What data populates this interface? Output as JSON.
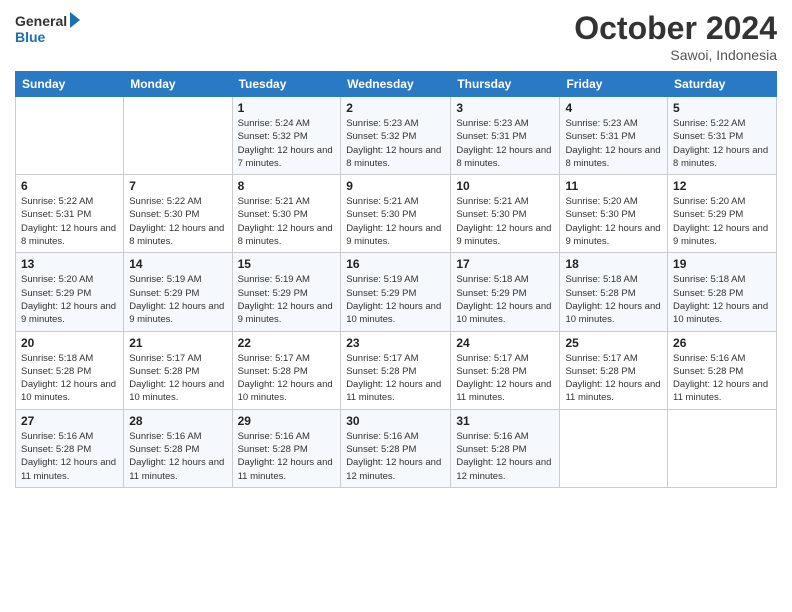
{
  "header": {
    "logo_general": "General",
    "logo_blue": "Blue",
    "month_title": "October 2024",
    "location": "Sawoi, Indonesia"
  },
  "days_of_week": [
    "Sunday",
    "Monday",
    "Tuesday",
    "Wednesday",
    "Thursday",
    "Friday",
    "Saturday"
  ],
  "weeks": [
    [
      {
        "day": "",
        "sunrise": "",
        "sunset": "",
        "daylight": ""
      },
      {
        "day": "",
        "sunrise": "",
        "sunset": "",
        "daylight": ""
      },
      {
        "day": "1",
        "sunrise": "Sunrise: 5:24 AM",
        "sunset": "Sunset: 5:32 PM",
        "daylight": "Daylight: 12 hours and 7 minutes."
      },
      {
        "day": "2",
        "sunrise": "Sunrise: 5:23 AM",
        "sunset": "Sunset: 5:32 PM",
        "daylight": "Daylight: 12 hours and 8 minutes."
      },
      {
        "day": "3",
        "sunrise": "Sunrise: 5:23 AM",
        "sunset": "Sunset: 5:31 PM",
        "daylight": "Daylight: 12 hours and 8 minutes."
      },
      {
        "day": "4",
        "sunrise": "Sunrise: 5:23 AM",
        "sunset": "Sunset: 5:31 PM",
        "daylight": "Daylight: 12 hours and 8 minutes."
      },
      {
        "day": "5",
        "sunrise": "Sunrise: 5:22 AM",
        "sunset": "Sunset: 5:31 PM",
        "daylight": "Daylight: 12 hours and 8 minutes."
      }
    ],
    [
      {
        "day": "6",
        "sunrise": "Sunrise: 5:22 AM",
        "sunset": "Sunset: 5:31 PM",
        "daylight": "Daylight: 12 hours and 8 minutes."
      },
      {
        "day": "7",
        "sunrise": "Sunrise: 5:22 AM",
        "sunset": "Sunset: 5:30 PM",
        "daylight": "Daylight: 12 hours and 8 minutes."
      },
      {
        "day": "8",
        "sunrise": "Sunrise: 5:21 AM",
        "sunset": "Sunset: 5:30 PM",
        "daylight": "Daylight: 12 hours and 8 minutes."
      },
      {
        "day": "9",
        "sunrise": "Sunrise: 5:21 AM",
        "sunset": "Sunset: 5:30 PM",
        "daylight": "Daylight: 12 hours and 9 minutes."
      },
      {
        "day": "10",
        "sunrise": "Sunrise: 5:21 AM",
        "sunset": "Sunset: 5:30 PM",
        "daylight": "Daylight: 12 hours and 9 minutes."
      },
      {
        "day": "11",
        "sunrise": "Sunrise: 5:20 AM",
        "sunset": "Sunset: 5:30 PM",
        "daylight": "Daylight: 12 hours and 9 minutes."
      },
      {
        "day": "12",
        "sunrise": "Sunrise: 5:20 AM",
        "sunset": "Sunset: 5:29 PM",
        "daylight": "Daylight: 12 hours and 9 minutes."
      }
    ],
    [
      {
        "day": "13",
        "sunrise": "Sunrise: 5:20 AM",
        "sunset": "Sunset: 5:29 PM",
        "daylight": "Daylight: 12 hours and 9 minutes."
      },
      {
        "day": "14",
        "sunrise": "Sunrise: 5:19 AM",
        "sunset": "Sunset: 5:29 PM",
        "daylight": "Daylight: 12 hours and 9 minutes."
      },
      {
        "day": "15",
        "sunrise": "Sunrise: 5:19 AM",
        "sunset": "Sunset: 5:29 PM",
        "daylight": "Daylight: 12 hours and 9 minutes."
      },
      {
        "day": "16",
        "sunrise": "Sunrise: 5:19 AM",
        "sunset": "Sunset: 5:29 PM",
        "daylight": "Daylight: 12 hours and 10 minutes."
      },
      {
        "day": "17",
        "sunrise": "Sunrise: 5:18 AM",
        "sunset": "Sunset: 5:29 PM",
        "daylight": "Daylight: 12 hours and 10 minutes."
      },
      {
        "day": "18",
        "sunrise": "Sunrise: 5:18 AM",
        "sunset": "Sunset: 5:28 PM",
        "daylight": "Daylight: 12 hours and 10 minutes."
      },
      {
        "day": "19",
        "sunrise": "Sunrise: 5:18 AM",
        "sunset": "Sunset: 5:28 PM",
        "daylight": "Daylight: 12 hours and 10 minutes."
      }
    ],
    [
      {
        "day": "20",
        "sunrise": "Sunrise: 5:18 AM",
        "sunset": "Sunset: 5:28 PM",
        "daylight": "Daylight: 12 hours and 10 minutes."
      },
      {
        "day": "21",
        "sunrise": "Sunrise: 5:17 AM",
        "sunset": "Sunset: 5:28 PM",
        "daylight": "Daylight: 12 hours and 10 minutes."
      },
      {
        "day": "22",
        "sunrise": "Sunrise: 5:17 AM",
        "sunset": "Sunset: 5:28 PM",
        "daylight": "Daylight: 12 hours and 10 minutes."
      },
      {
        "day": "23",
        "sunrise": "Sunrise: 5:17 AM",
        "sunset": "Sunset: 5:28 PM",
        "daylight": "Daylight: 12 hours and 11 minutes."
      },
      {
        "day": "24",
        "sunrise": "Sunrise: 5:17 AM",
        "sunset": "Sunset: 5:28 PM",
        "daylight": "Daylight: 12 hours and 11 minutes."
      },
      {
        "day": "25",
        "sunrise": "Sunrise: 5:17 AM",
        "sunset": "Sunset: 5:28 PM",
        "daylight": "Daylight: 12 hours and 11 minutes."
      },
      {
        "day": "26",
        "sunrise": "Sunrise: 5:16 AM",
        "sunset": "Sunset: 5:28 PM",
        "daylight": "Daylight: 12 hours and 11 minutes."
      }
    ],
    [
      {
        "day": "27",
        "sunrise": "Sunrise: 5:16 AM",
        "sunset": "Sunset: 5:28 PM",
        "daylight": "Daylight: 12 hours and 11 minutes."
      },
      {
        "day": "28",
        "sunrise": "Sunrise: 5:16 AM",
        "sunset": "Sunset: 5:28 PM",
        "daylight": "Daylight: 12 hours and 11 minutes."
      },
      {
        "day": "29",
        "sunrise": "Sunrise: 5:16 AM",
        "sunset": "Sunset: 5:28 PM",
        "daylight": "Daylight: 12 hours and 11 minutes."
      },
      {
        "day": "30",
        "sunrise": "Sunrise: 5:16 AM",
        "sunset": "Sunset: 5:28 PM",
        "daylight": "Daylight: 12 hours and 12 minutes."
      },
      {
        "day": "31",
        "sunrise": "Sunrise: 5:16 AM",
        "sunset": "Sunset: 5:28 PM",
        "daylight": "Daylight: 12 hours and 12 minutes."
      },
      {
        "day": "",
        "sunrise": "",
        "sunset": "",
        "daylight": ""
      },
      {
        "day": "",
        "sunrise": "",
        "sunset": "",
        "daylight": ""
      }
    ]
  ]
}
